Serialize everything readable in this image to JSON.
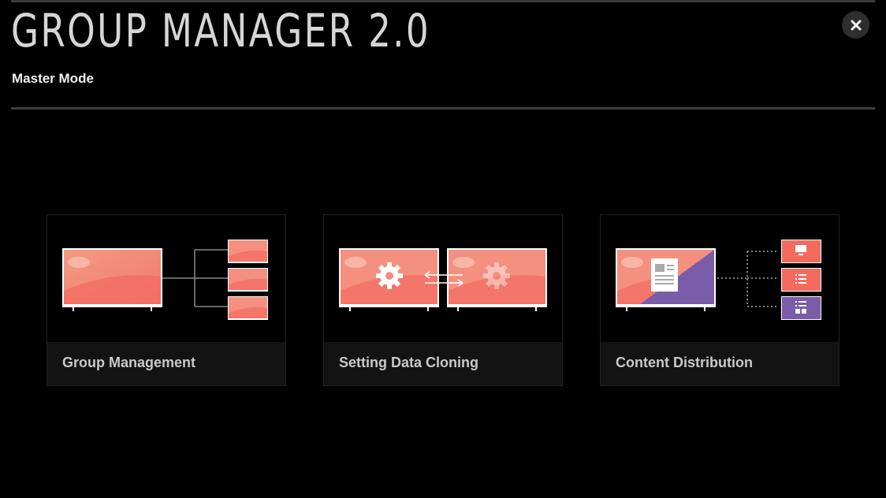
{
  "header": {
    "title": "GROUP MANAGER 2.0",
    "mode": "Master Mode",
    "close_icon": "close-icon"
  },
  "cards": [
    {
      "label": "Group Management",
      "icon": "group-management-illustration"
    },
    {
      "label": "Setting Data Cloning",
      "icon": "setting-data-cloning-illustration"
    },
    {
      "label": "Content Distribution",
      "icon": "content-distribution-illustration"
    }
  ],
  "colors": {
    "background": "#000000",
    "screen_salmon": "#f4907f",
    "screen_accent": "#ff6b5e",
    "purple": "#7a5ca8",
    "card_label_bg": "#131313"
  }
}
